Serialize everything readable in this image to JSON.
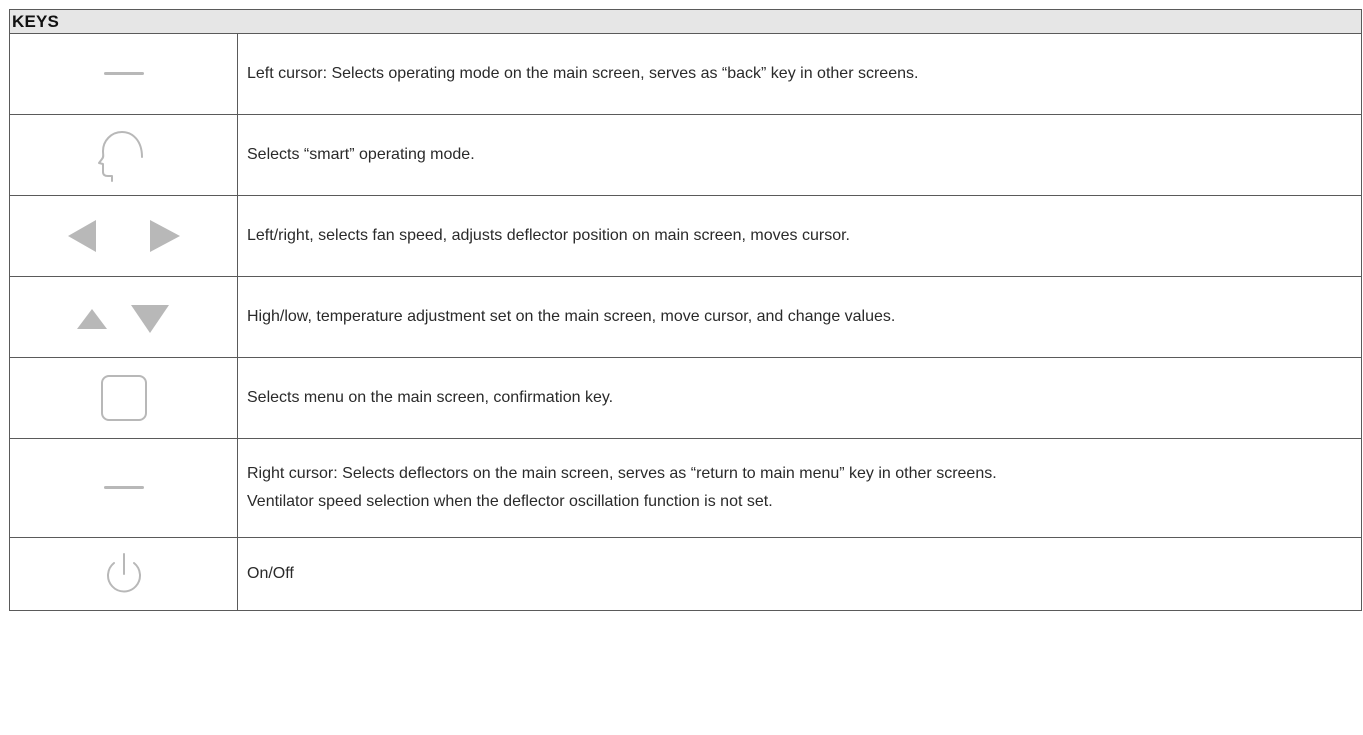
{
  "table": {
    "header": "KEYS",
    "rows": [
      {
        "icon": "left-cursor-dash-icon",
        "lines": [
          "Left cursor: Selects operating mode on the main screen, serves as “back” key in other screens."
        ]
      },
      {
        "icon": "smart-head-icon",
        "lines": [
          "Selects “smart” operating mode."
        ]
      },
      {
        "icon": "left-right-arrows-icon",
        "lines": [
          "Left/right, selects fan speed, adjusts deflector position on main screen, moves cursor."
        ]
      },
      {
        "icon": "up-down-arrows-icon",
        "lines": [
          "High/low, temperature adjustment set on the main screen, move cursor, and change values."
        ]
      },
      {
        "icon": "menu-square-icon",
        "lines": [
          "Selects menu on the main screen, confirmation key."
        ]
      },
      {
        "icon": "right-cursor-dash-icon",
        "lines": [
          "Right cursor: Selects deflectors on the main screen, serves as “return to main menu” key in other screens.",
          "Ventilator speed selection when the deflector oscillation function is not set."
        ]
      },
      {
        "icon": "power-icon",
        "lines": [
          "On/Off"
        ]
      }
    ]
  },
  "colors": {
    "icon_gray": "#b8b8b8",
    "border": "#5a5a5a",
    "header_bg": "#e6e6e6"
  }
}
